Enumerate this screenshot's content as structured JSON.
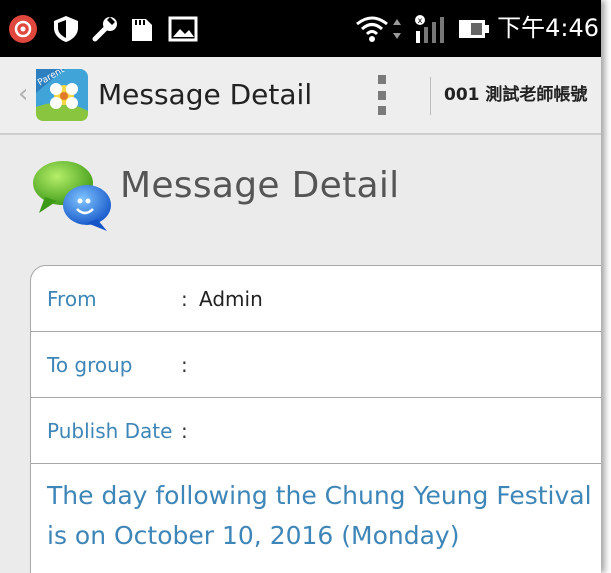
{
  "status_bar": {
    "time": "下午4:46",
    "icons": [
      "notification-icon",
      "shield-icon",
      "wrench-icon",
      "sd-card-icon",
      "picture-icon",
      "wifi-icon",
      "signal-icon",
      "battery-icon"
    ]
  },
  "action_bar": {
    "title": "Message Detail",
    "account": "001 測試老師帳號",
    "logo_text": "Parent"
  },
  "page": {
    "title": "Message Detail"
  },
  "detail": {
    "from_label": "From",
    "from_colon": ":",
    "from_value": "Admin",
    "to_group_label": "To group",
    "to_group_colon": ":",
    "to_group_value": "",
    "publish_date_label": "Publish Date",
    "publish_date_colon": ":",
    "publish_date_value": "",
    "message": "The day following the Chung Yeung Festival is on October 10, 2016 (Monday)"
  },
  "colors": {
    "label_blue": "#3f86b8",
    "status_bar_bg": "#000000",
    "action_bar_bg": "#eeeeee",
    "content_bg": "#ebebeb",
    "notification_red": "#e0483e"
  }
}
